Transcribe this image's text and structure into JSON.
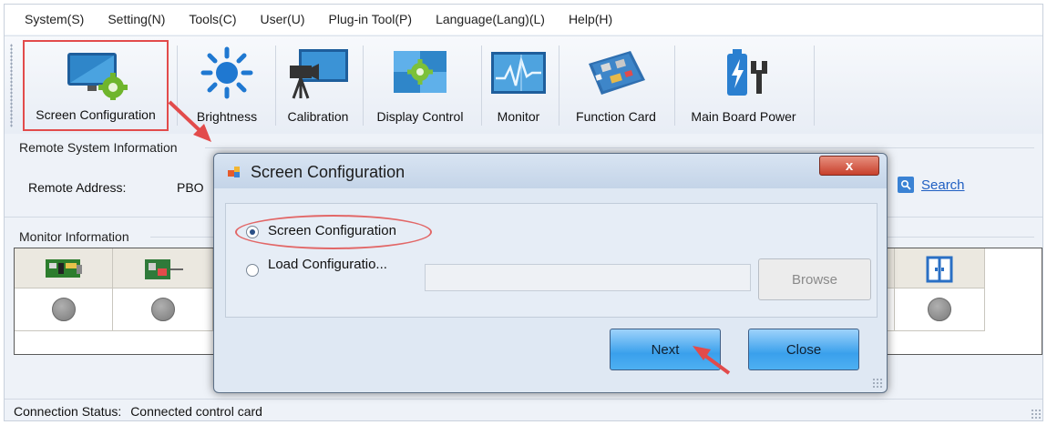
{
  "menubar": {
    "items": [
      "System(S)",
      "Setting(N)",
      "Tools(C)",
      "User(U)",
      "Plug-in Tool(P)",
      "Language(Lang)(L)",
      "Help(H)"
    ]
  },
  "toolbar": {
    "items": [
      {
        "label": "Screen Configuration",
        "icon": "screen-config-icon",
        "selected": true
      },
      {
        "label": "Brightness",
        "icon": "brightness-icon"
      },
      {
        "label": "Calibration",
        "icon": "calibration-icon"
      },
      {
        "label": "Display Control",
        "icon": "display-control-icon"
      },
      {
        "label": "Monitor",
        "icon": "monitor-icon"
      },
      {
        "label": "Function Card",
        "icon": "function-card-icon"
      },
      {
        "label": "Main Board Power",
        "icon": "main-board-power-icon"
      }
    ]
  },
  "remote": {
    "section_title": "Remote System Information",
    "address_label": "Remote Address:",
    "address_value": "PBO",
    "search_label": "Search"
  },
  "monitor": {
    "section_title": "Monitor Information"
  },
  "status": {
    "label": "Connection Status:",
    "value": "Connected control card"
  },
  "dialog": {
    "title": "Screen Configuration",
    "close_label": "x",
    "option_screen": "Screen Configuration",
    "option_load": "Load Configuratio...",
    "load_path": "",
    "browse_label": "Browse",
    "next_label": "Next",
    "close_button_label": "Close",
    "selected_option": "screen"
  },
  "colors": {
    "highlight": "#e24b4b",
    "link": "#1f5fc2",
    "button_blue": "#3aa0ec"
  }
}
